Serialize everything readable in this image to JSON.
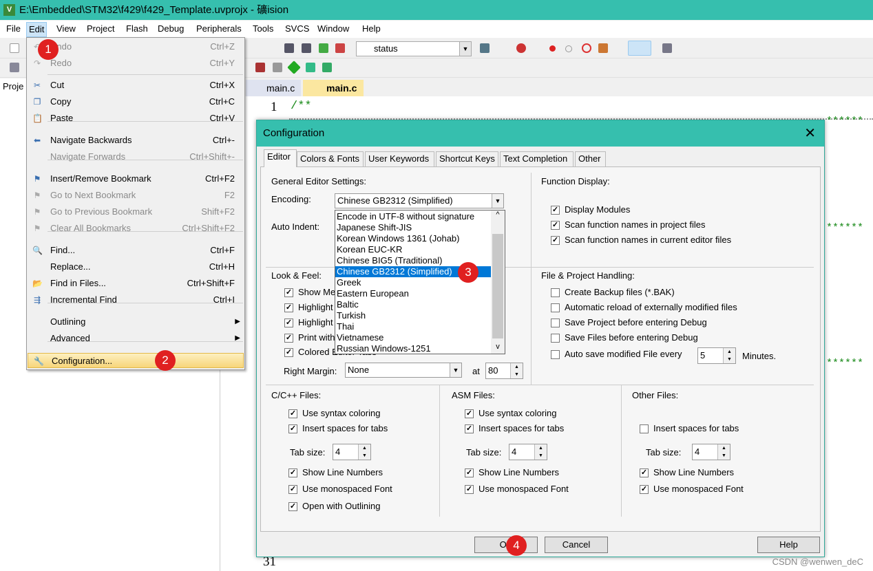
{
  "window": {
    "title": "E:\\Embedded\\STM32\\f429\\f429_Template.uvprojx - 礦ision",
    "icon": "uvision-icon"
  },
  "menubar": [
    "File",
    "Edit",
    "View",
    "Project",
    "Flash",
    "Debug",
    "Peripherals",
    "Tools",
    "SVCS",
    "Window",
    "Help"
  ],
  "toolbar": {
    "status_value": "status"
  },
  "project_pane": {
    "tab": "Proje"
  },
  "editor": {
    "tabs": [
      "main.c",
      "main.c"
    ],
    "active_tab": 1,
    "line_numbers": [
      "1",
      "31"
    ],
    "line1": "/**",
    "stars": "******"
  },
  "edit_menu": {
    "items": [
      {
        "label": "Undo",
        "shortcut": "Ctrl+Z",
        "disabled": true,
        "icon": "undo-icon"
      },
      {
        "label": "Redo",
        "shortcut": "Ctrl+Y",
        "disabled": true,
        "icon": "redo-icon"
      },
      {
        "label": "Cut",
        "shortcut": "Ctrl+X",
        "icon": "scissors-icon"
      },
      {
        "label": "Copy",
        "shortcut": "Ctrl+C",
        "icon": "copy-icon"
      },
      {
        "label": "Paste",
        "shortcut": "Ctrl+V",
        "icon": "paste-icon"
      },
      {
        "label": "Navigate Backwards",
        "shortcut": "Ctrl+-",
        "icon": "arrow-left-icon"
      },
      {
        "label": "Navigate Forwards",
        "shortcut": "Ctrl+Shift+-",
        "disabled": true
      },
      {
        "label": "Insert/Remove Bookmark",
        "shortcut": "Ctrl+F2",
        "icon": "bookmark-icon"
      },
      {
        "label": "Go to Next Bookmark",
        "shortcut": "F2",
        "disabled": true,
        "icon": "bookmark-next-icon"
      },
      {
        "label": "Go to Previous Bookmark",
        "shortcut": "Shift+F2",
        "disabled": true,
        "icon": "bookmark-prev-icon"
      },
      {
        "label": "Clear All Bookmarks",
        "shortcut": "Ctrl+Shift+F2",
        "disabled": true,
        "icon": "bookmark-clear-icon"
      },
      {
        "label": "Find...",
        "shortcut": "Ctrl+F",
        "icon": "find-icon"
      },
      {
        "label": "Replace...",
        "shortcut": "Ctrl+H"
      },
      {
        "label": "Find in Files...",
        "shortcut": "Ctrl+Shift+F",
        "icon": "find-in-files-icon"
      },
      {
        "label": "Incremental Find",
        "shortcut": "Ctrl+I",
        "icon": "incremental-find-icon"
      },
      {
        "label": "Outlining",
        "submenu": true
      },
      {
        "label": "Advanced",
        "submenu": true
      },
      {
        "label": "Configuration...",
        "highlighted": true,
        "icon": "wrench-icon"
      }
    ]
  },
  "dialog": {
    "title": "Configuration",
    "tabs": [
      "Editor",
      "Colors & Fonts",
      "User Keywords",
      "Shortcut Keys",
      "Text Completion",
      "Other"
    ],
    "active_tab": "Editor",
    "general": {
      "title": "General Editor Settings:",
      "encoding_label": "Encoding:",
      "encoding_value": "Chinese GB2312 (Simplified)",
      "auto_indent_label": "Auto Indent:",
      "encoding_options": [
        "Encode in UTF-8 without signature",
        "Japanese Shift-JIS",
        "Korean Windows 1361 (Johab)",
        "Korean EUC-KR",
        "Chinese BIG5 (Traditional)",
        "Chinese GB2312 (Simplified)",
        "Greek",
        "Eastern European",
        "Baltic",
        "Turkish",
        "Thai",
        "Vietnamese",
        "Russian Windows-1251"
      ],
      "selected_option": 5
    },
    "function_display": {
      "title": "Function Display:",
      "items": [
        {
          "label": "Display Modules",
          "checked": true
        },
        {
          "label": "Scan function names in project files",
          "checked": true
        },
        {
          "label": "Scan function names in current editor files",
          "checked": true
        }
      ]
    },
    "look_feel": {
      "title": "Look & Feel:",
      "items": [
        {
          "label": "Show Me",
          "checked": true
        },
        {
          "label": "Highlight",
          "checked": true
        },
        {
          "label": "Highlight",
          "checked": true
        },
        {
          "label": "Print with",
          "checked": true
        },
        {
          "label": "Colored Editor Tabs",
          "checked": true
        }
      ],
      "right_margin_label": "Right Margin:",
      "right_margin_value": "None",
      "at_label": "at",
      "at_value": "80"
    },
    "file_project": {
      "title": "File & Project Handling:",
      "items": [
        {
          "label": "Create Backup files (*.BAK)",
          "checked": false
        },
        {
          "label": "Automatic reload of externally modified files",
          "checked": false
        },
        {
          "label": "Save Project before entering Debug",
          "checked": false
        },
        {
          "label": "Save Files before entering Debug",
          "checked": false
        },
        {
          "label": "Auto save modified File every",
          "checked": false
        }
      ],
      "autosave_value": "5",
      "minutes_label": "Minutes."
    },
    "cpp": {
      "title": "C/C++ Files:",
      "syntax": "Use syntax coloring",
      "spaces": "Insert spaces for tabs",
      "tab_size_label": "Tab size:",
      "tab_size": "4",
      "line_numbers": "Show Line Numbers",
      "mono": "Use monospaced Font",
      "outlining": "Open with Outlining"
    },
    "asm": {
      "title": "ASM Files:",
      "syntax": "Use syntax coloring",
      "spaces": "Insert spaces for tabs",
      "tab_size_label": "Tab size:",
      "tab_size": "4",
      "line_numbers": "Show Line Numbers",
      "mono": "Use monospaced Font"
    },
    "other": {
      "title": "Other Files:",
      "spaces": "Insert spaces for tabs",
      "spaces_checked": false,
      "tab_size_label": "Tab size:",
      "tab_size": "4",
      "line_numbers": "Show Line Numbers",
      "mono": "Use monospaced Font"
    },
    "buttons": {
      "ok": "OK",
      "cancel": "Cancel",
      "help": "Help"
    }
  },
  "badges": [
    "1",
    "2",
    "3",
    "4"
  ],
  "watermark": "CSDN @wenwen_deC",
  "colors": {
    "titlebar": "#36bfae",
    "selection": "#0078d7",
    "badge": "#e02020"
  }
}
